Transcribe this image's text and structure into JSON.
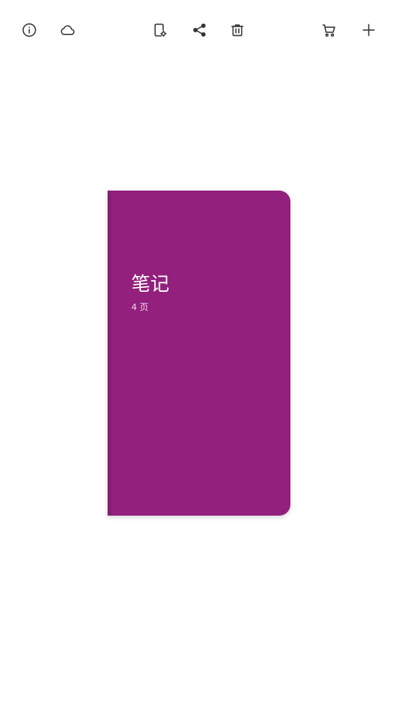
{
  "toolbar": {
    "left_icons": [
      "info-icon",
      "cloud-icon"
    ],
    "center_icons": [
      "page-settings-icon",
      "share-icon",
      "delete-icon"
    ],
    "right_icons": [
      "cart-icon",
      "add-icon"
    ]
  },
  "notebook": {
    "title": "笔记",
    "pages": "4 页",
    "cover_color": "#92207c"
  }
}
